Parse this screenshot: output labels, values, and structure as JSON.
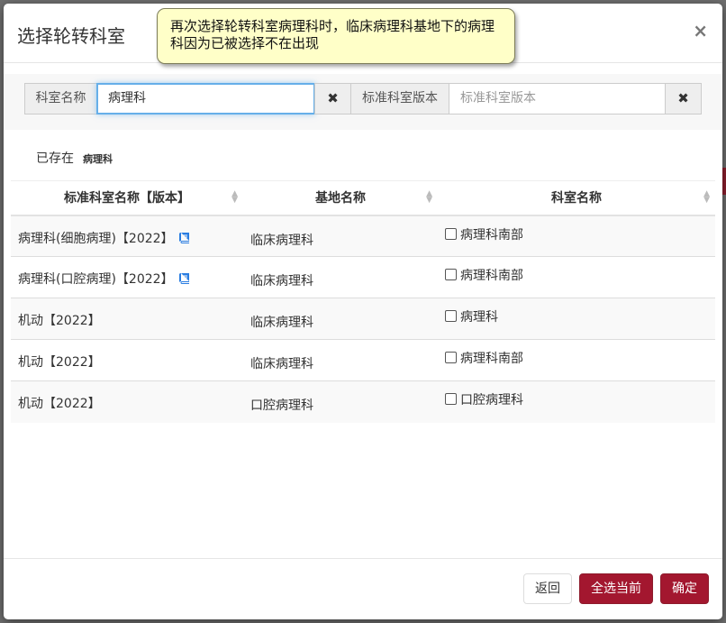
{
  "modal": {
    "title": "选择轮转科室",
    "close": "×"
  },
  "tooltip": {
    "text": "再次选择轮转科室病理科时，临床病理科基地下的病理科因为已被选择不在出现"
  },
  "search": {
    "dept_label": "科室名称",
    "dept_value": "病理科",
    "clear_glyph": "✖",
    "version_label": "标准科室版本",
    "version_placeholder": "标准科室版本"
  },
  "exists": {
    "label": "已存在",
    "tag": "病理科"
  },
  "table": {
    "headers": [
      "标准科室名称【版本】",
      "基地名称",
      "科室名称"
    ],
    "rows": [
      {
        "std": "病理科(细胞病理)【2022】",
        "base": "临床病理科",
        "dept": "病理科南部",
        "book": true
      },
      {
        "std": "病理科(口腔病理)【2022】",
        "base": "临床病理科",
        "dept": "病理科南部",
        "book": true
      },
      {
        "std": "机动【2022】",
        "base": "临床病理科",
        "dept": "病理科",
        "book": false
      },
      {
        "std": "机动【2022】",
        "base": "临床病理科",
        "dept": "病理科南部",
        "book": false
      },
      {
        "std": "机动【2022】",
        "base": "口腔病理科",
        "dept": "口腔病理科",
        "book": false
      }
    ]
  },
  "footer": {
    "back": "返回",
    "select_all": "全选当前",
    "confirm": "确定"
  },
  "colors": {
    "primary": "#a3172f",
    "tooltip_bg": "#ffffc8",
    "icon_blue": "#2a7de1"
  }
}
